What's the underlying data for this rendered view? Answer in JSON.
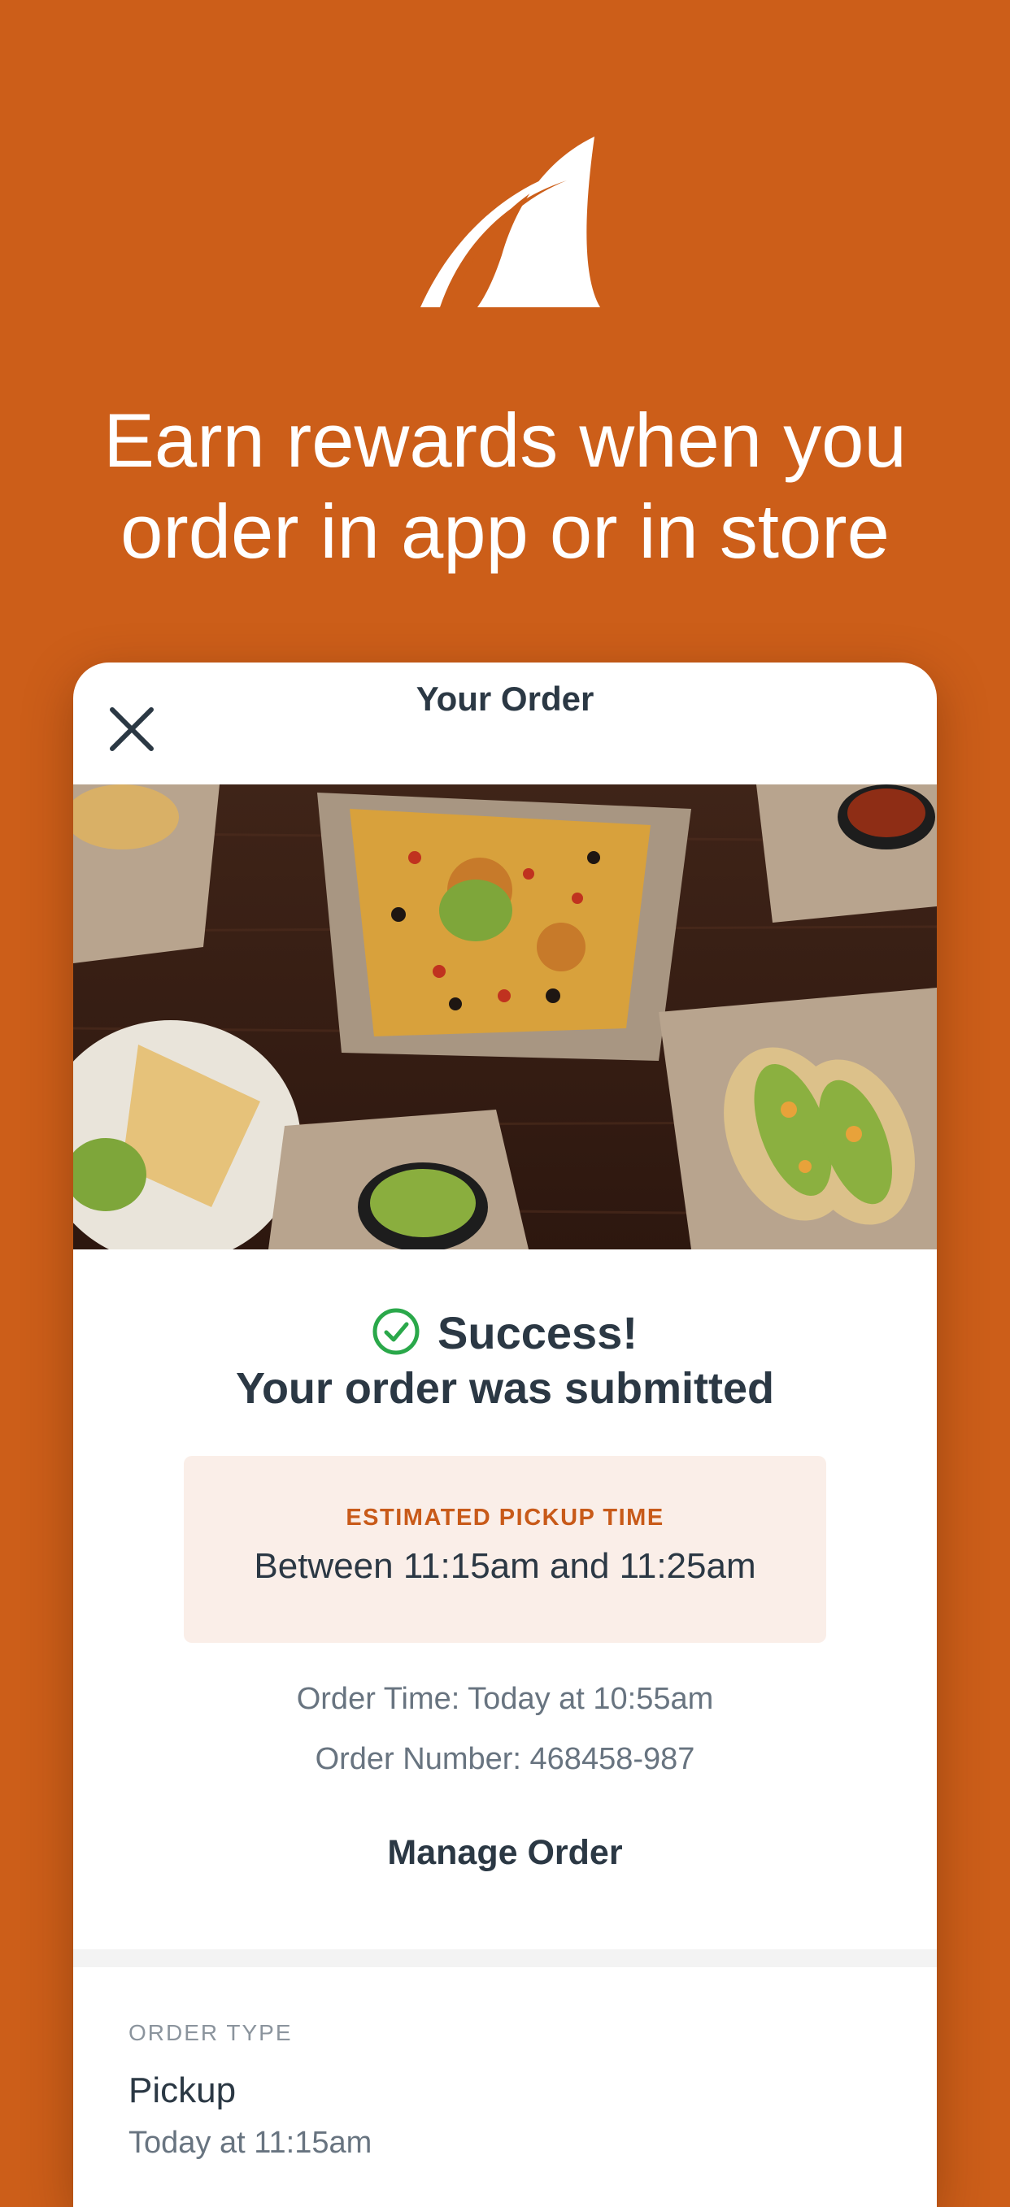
{
  "hero": {
    "logo_icon": "shark-fin-logo",
    "headline_line1": "Earn rewards when you",
    "headline_line2": "order in app or in store"
  },
  "order_card": {
    "title": "Your Order",
    "close_icon": "close-icon",
    "photo_icon": "food-photo",
    "success_title": "Success!",
    "success_subtitle": "Your order was submitted",
    "pickup": {
      "label": "ESTIMATED PICKUP TIME",
      "window": "Between 11:15am and 11:25am"
    },
    "order_time": "Order Time: Today at 10:55am",
    "order_number": "Order Number: 468458-987",
    "manage_label": "Manage Order",
    "order_type": {
      "label": "ORDER TYPE",
      "value": "Pickup",
      "time": "Today at 11:15am"
    }
  },
  "colors": {
    "background": "#cc5e19",
    "accent": "#c85a19",
    "success": "#2aa84a",
    "text_dark": "#2b3844",
    "pickup_bg": "#faeee8"
  }
}
